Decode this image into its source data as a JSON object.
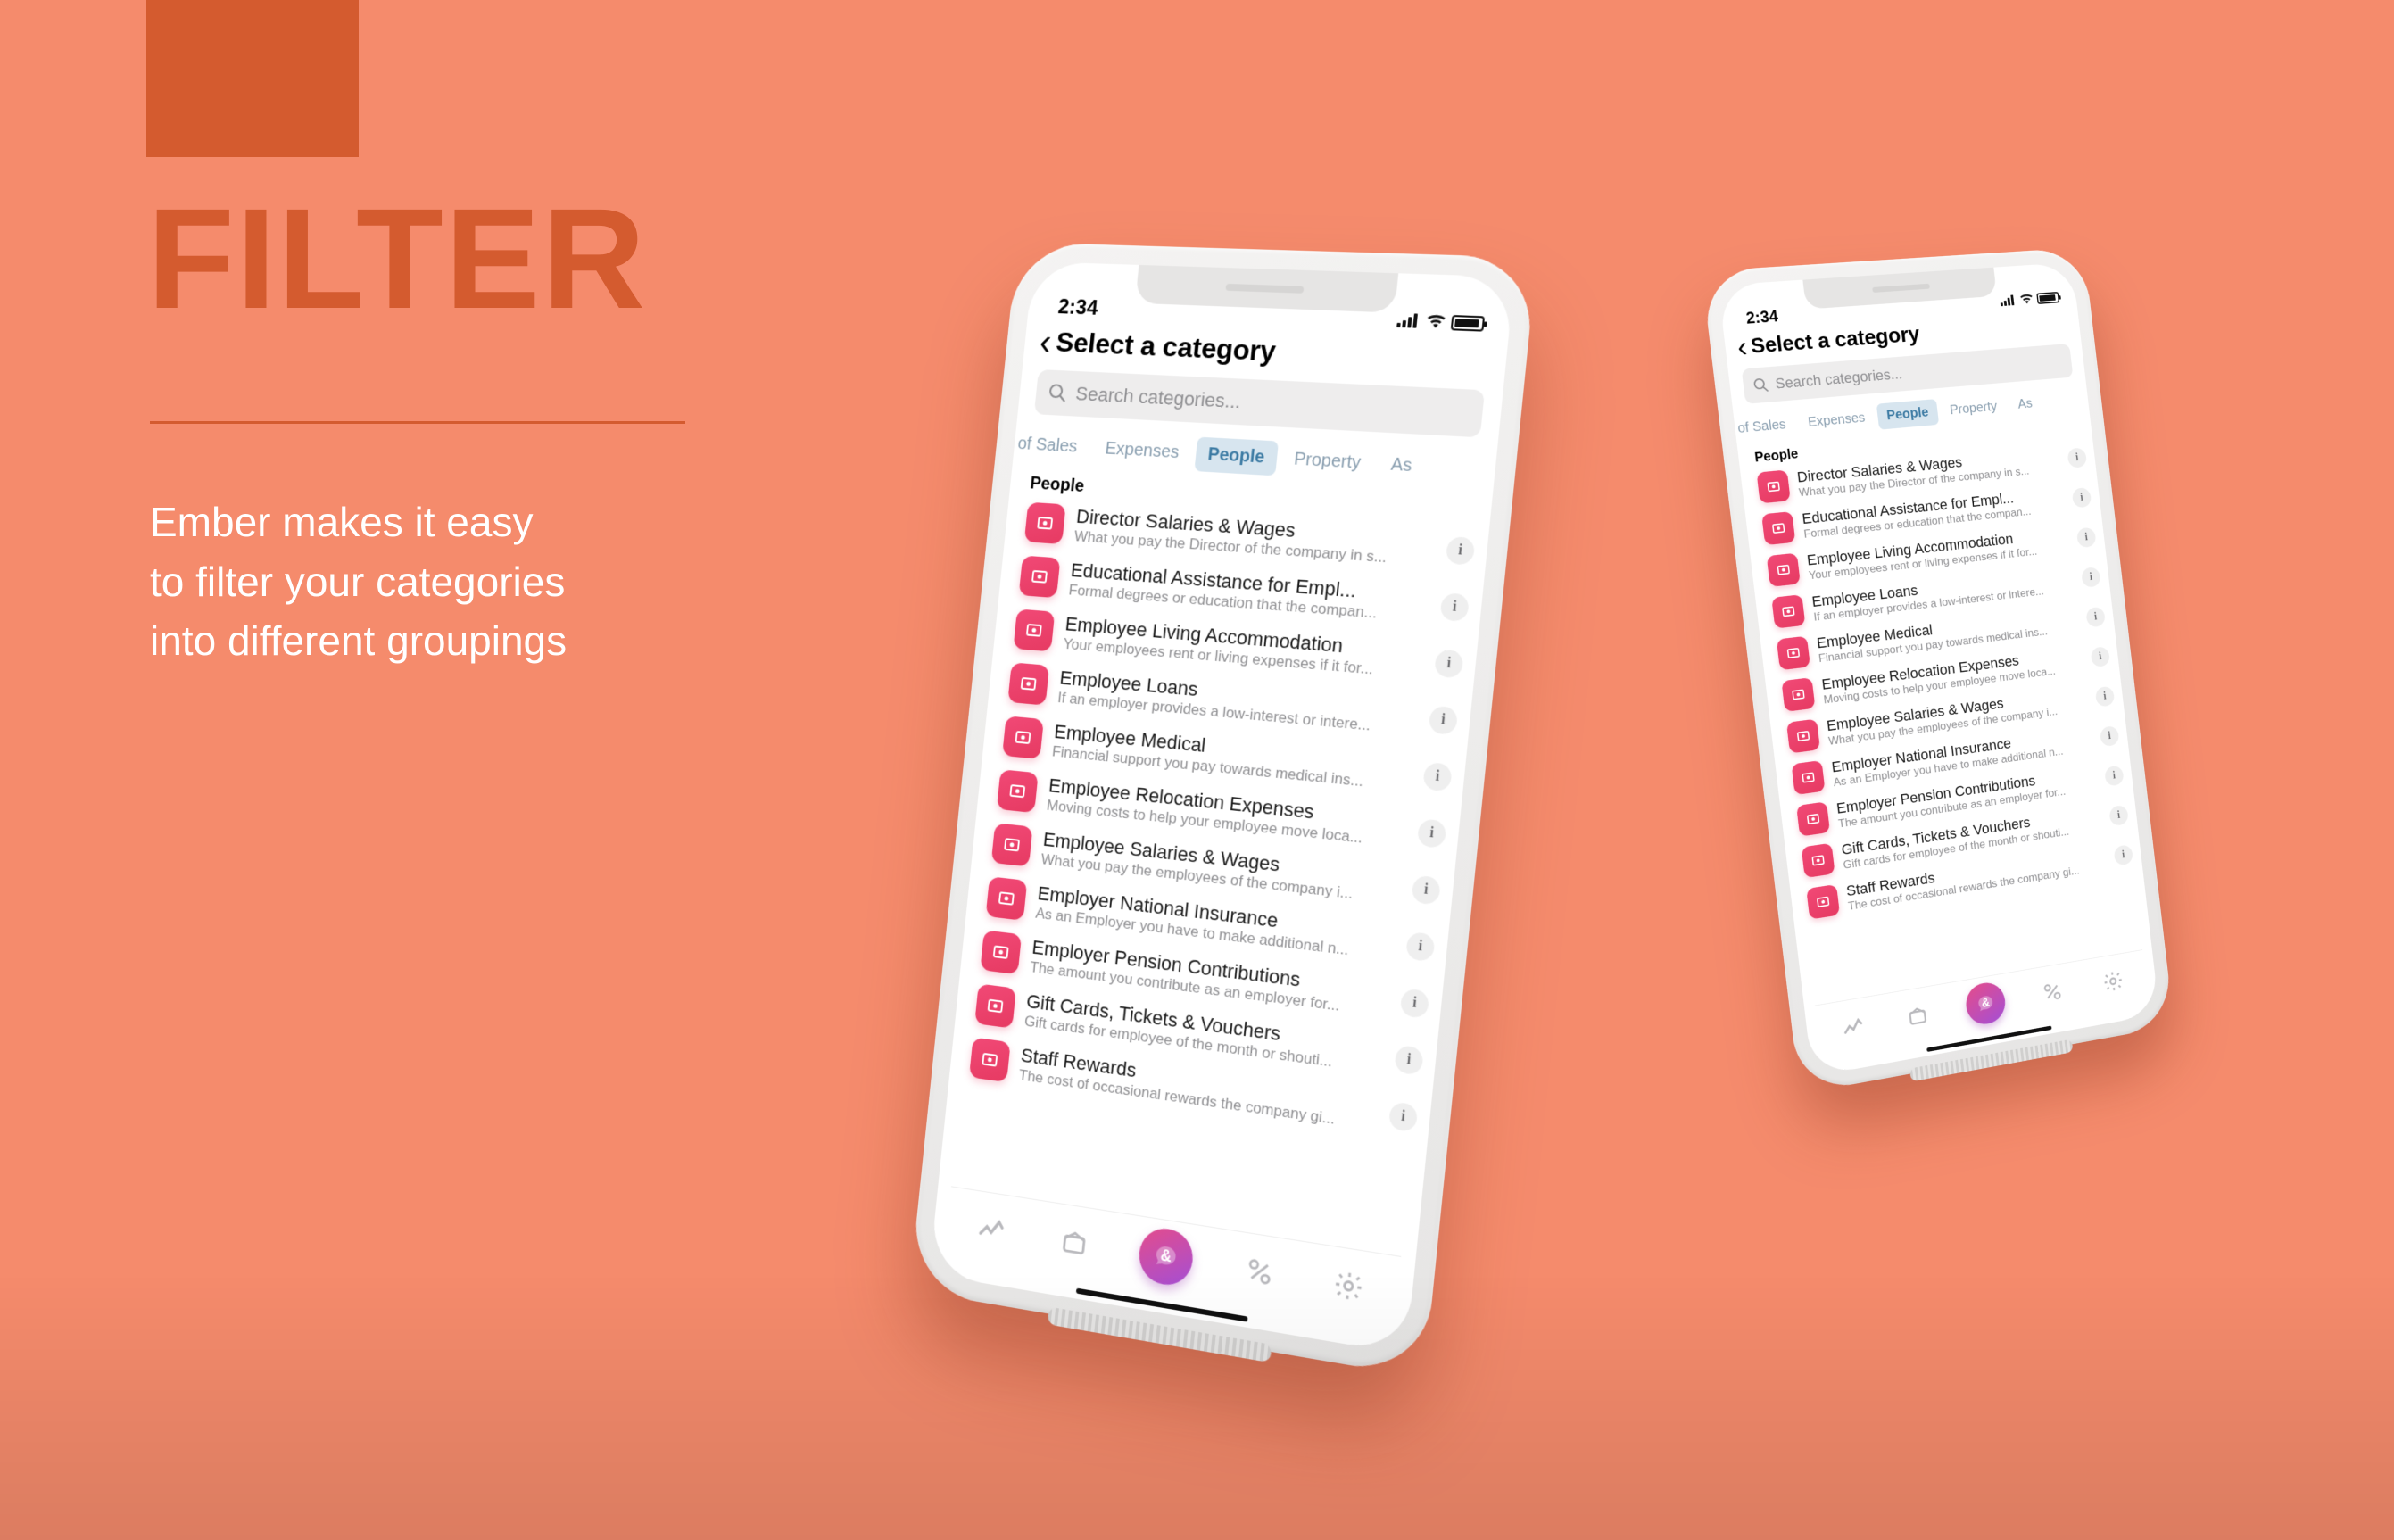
{
  "headline": "FILTER",
  "copy_line1": "Ember makes it easy",
  "copy_line2": "to filter your categories",
  "copy_line3": "into different groupings",
  "status": {
    "time": "2:34"
  },
  "nav": {
    "title": "Select a category"
  },
  "search": {
    "placeholder": "Search categories..."
  },
  "tabs": {
    "items": [
      {
        "label": "of Sales",
        "active": false
      },
      {
        "label": "Expenses",
        "active": false
      },
      {
        "label": "People",
        "active": true
      },
      {
        "label": "Property",
        "active": false
      },
      {
        "label": "As",
        "active": false
      }
    ],
    "section_label": "People"
  },
  "categories": [
    {
      "title": "Director Salaries & Wages",
      "sub": "What you pay the Director of the company in s..."
    },
    {
      "title": "Educational Assistance for Empl...",
      "sub": "Formal degrees or education that the compan..."
    },
    {
      "title": "Employee Living Accommodation",
      "sub": "Your employees rent or living expenses if it for..."
    },
    {
      "title": "Employee Loans",
      "sub": "If an employer provides a low-interest or intere..."
    },
    {
      "title": "Employee Medical",
      "sub": "Financial support you pay towards medical ins..."
    },
    {
      "title": "Employee Relocation Expenses",
      "sub": "Moving costs to help your employee move loca..."
    },
    {
      "title": "Employee Salaries & Wages",
      "sub": "What you pay the employees of the company i..."
    },
    {
      "title": "Employer National Insurance",
      "sub": "As an Employer you have to make additional n..."
    },
    {
      "title": "Employer Pension Contributions",
      "sub": "The amount you contribute as an employer for..."
    },
    {
      "title": "Gift Cards, Tickets & Vouchers",
      "sub": "Gift cards for employee of the month or shouti..."
    },
    {
      "title": "Staff Rewards",
      "sub": "The cost of occasional rewards the company gi..."
    }
  ]
}
